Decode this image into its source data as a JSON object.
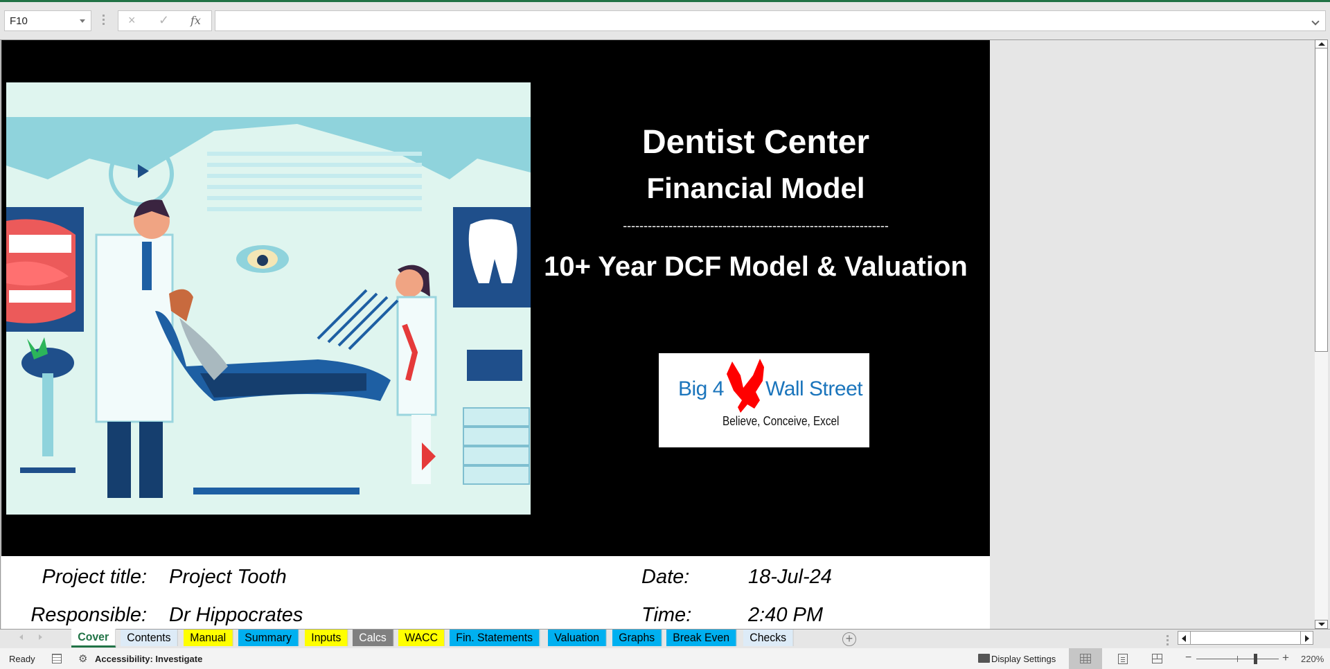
{
  "formula_bar": {
    "name_box": "F10",
    "cancel_icon": "×",
    "enter_icon": "✓",
    "fx_label": "fx",
    "formula_value": ""
  },
  "cover": {
    "title_line1": "Dentist Center",
    "title_line2": "Financial Model",
    "divider": "----------------------------------------------------------------",
    "subtitle": "10+ Year DCF Model & Valuation",
    "illustration_alt": "Dental clinic illustration: dentist, patient in chair, assistant",
    "logo": {
      "left_text": "Big 4",
      "right_text": "Wall Street",
      "tagline": "Believe, Conceive, Excel",
      "brand_color": "#1b75bc",
      "eagle_color": "#ff0000"
    },
    "info": {
      "project_title_label": "Project title:",
      "project_title_value": "Project Tooth",
      "responsible_label": "Responsible:",
      "responsible_value": "Dr Hippocrates",
      "date_label": "Date:",
      "date_value": "18-Jul-24",
      "time_label": "Time:",
      "time_value": "2:40 PM"
    }
  },
  "sheet_tabs": [
    {
      "label": "Cover",
      "color": "#ffffff",
      "active": true
    },
    {
      "label": "Contents",
      "color": "#ddebf7",
      "active": false
    },
    {
      "label": "Manual",
      "color": "#ffff00",
      "active": false
    },
    {
      "label": "Summary",
      "color": "#00b0f0",
      "active": false
    },
    {
      "label": "Inputs",
      "color": "#ffff00",
      "active": false
    },
    {
      "label": "Calcs",
      "color": "#808080",
      "active": false
    },
    {
      "label": "WACC",
      "color": "#ffff00",
      "active": false
    },
    {
      "label": "Fin. Statements",
      "color": "#00b0f0",
      "active": false
    },
    {
      "label": "Valuation",
      "color": "#00b0f0",
      "active": false
    },
    {
      "label": "Graphs",
      "color": "#00b0f0",
      "active": false
    },
    {
      "label": "Break Even",
      "color": "#00b0f0",
      "active": false
    },
    {
      "label": "Checks",
      "color": "#ddebf7",
      "active": false
    }
  ],
  "add_sheet_label": "+",
  "status_bar": {
    "ready": "Ready",
    "accessibility": "Accessibility: Investigate",
    "display_settings": "Display Settings",
    "zoom_minus": "−",
    "zoom_plus": "+",
    "zoom_level": "220%"
  }
}
